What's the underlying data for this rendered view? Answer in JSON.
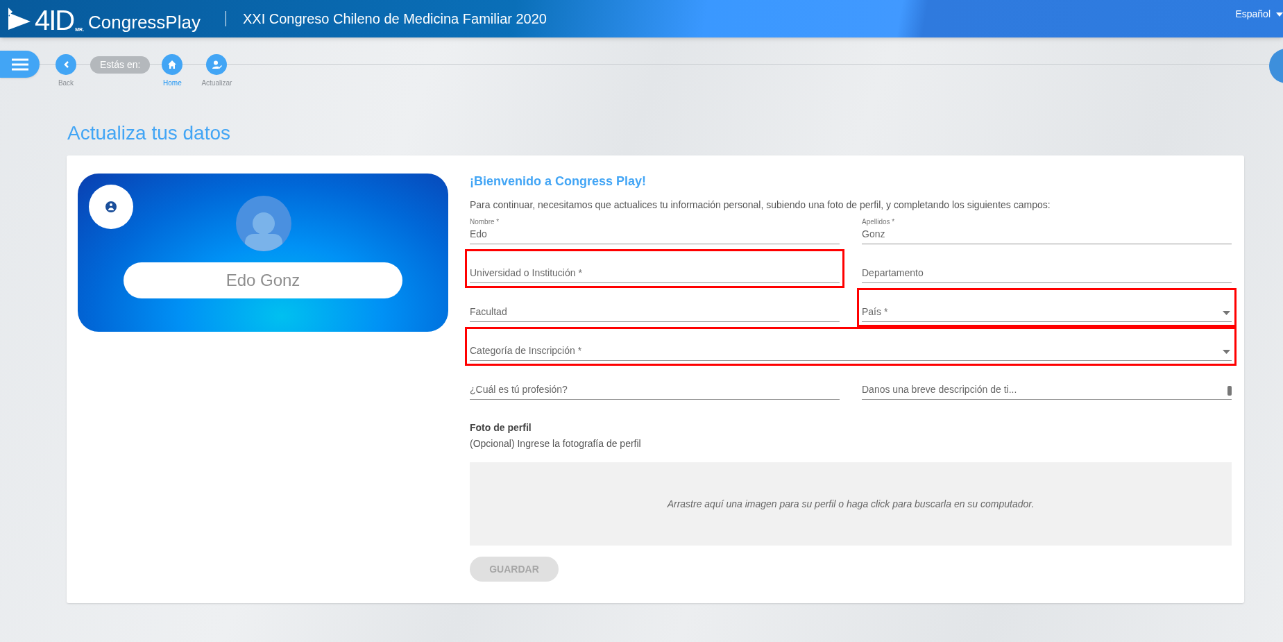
{
  "header": {
    "logo_text": "4ID",
    "logo_mark": "MR.",
    "brand": "CongressPlay",
    "title": "XXI Congreso Chileno de Medicina Familiar 2020",
    "language": "Español"
  },
  "breadcrumb": {
    "prefix": "Estás en:",
    "items": [
      {
        "kind": "back",
        "label": "Back",
        "selected": false
      },
      {
        "kind": "home",
        "label": "Home",
        "selected": true
      },
      {
        "kind": "edit",
        "label": "Actualizar",
        "selected": false
      }
    ]
  },
  "page_title": "Actualiza tus datos",
  "profile": {
    "name": "Edo Gonz"
  },
  "form": {
    "title": "¡Bienvenido a Congress Play!",
    "intro": "Para continuar, necesitamos que actualices tu información personal, subiendo una foto de perfil, y completando los siguientes campos:",
    "fields": [
      {
        "kind": "text",
        "label": "Nombre *",
        "value": "Edo",
        "highlighted": false,
        "wide": false
      },
      {
        "kind": "text",
        "label": "Apellidos *",
        "value": "Gonz",
        "highlighted": false,
        "wide": false
      },
      {
        "kind": "text",
        "label": "Universidad o Institución *",
        "highlighted": true,
        "wide": false
      },
      {
        "kind": "text",
        "label": "Departamento",
        "highlighted": false,
        "wide": false
      },
      {
        "kind": "text",
        "label": "Facultad",
        "highlighted": false,
        "wide": false
      },
      {
        "kind": "select",
        "label": "País *",
        "highlighted": true,
        "wide": false
      },
      {
        "kind": "select",
        "label": "Categoría de Inscripción *",
        "highlighted": true,
        "wide": true
      },
      {
        "kind": "text",
        "label": "¿Cuál es tú profesión?",
        "highlighted": false,
        "wide": false
      },
      {
        "kind": "textarea",
        "label": "Danos una breve descripción de ti...",
        "highlighted": false,
        "wide": false
      }
    ],
    "photo_title": "Foto de perfil",
    "photo_hint": "(Opcional) Ingrese la fotografía de perfil",
    "dropzone": "Arrastre aquí una imagen para su perfil o haga click para buscarla en su computador.",
    "save": {
      "label": "GUARDAR",
      "disabled": true
    }
  }
}
